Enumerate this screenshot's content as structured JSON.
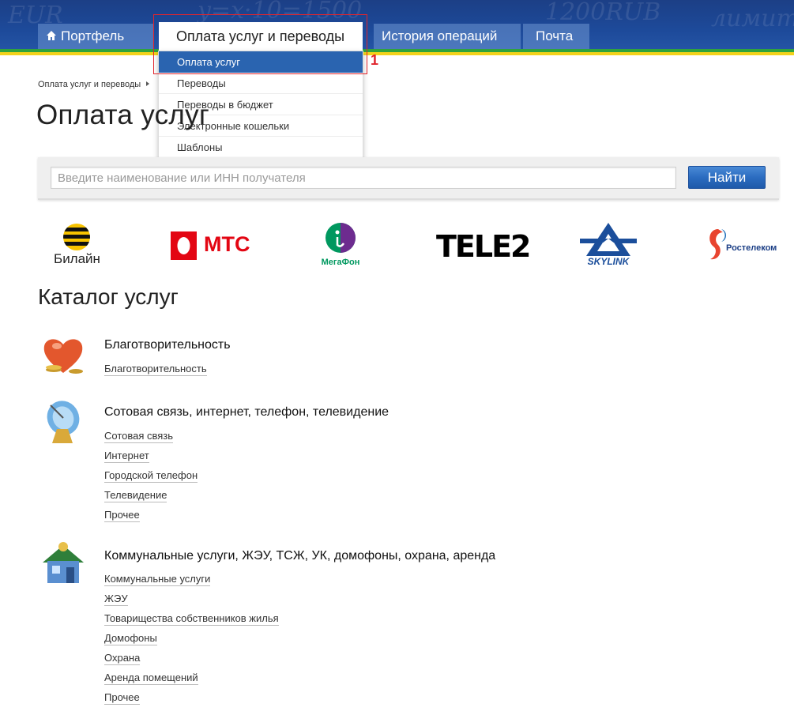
{
  "header": {
    "nav": {
      "portfolio": "Портфель",
      "payments": "Оплата услуг и переводы",
      "history": "История операций",
      "mail": "Почта"
    },
    "scribbles": [
      "EUR",
      "y=x·10=1500",
      "1200RUB",
      "лимит"
    ]
  },
  "dropdown": {
    "items": [
      "Оплата услуг",
      "Переводы",
      "Переводы в бюджет",
      "Электронные кошельки",
      "Шаблоны"
    ],
    "annotation": "1"
  },
  "breadcrumb": "Оплата услуг и переводы",
  "page_title": "Оплата услуг",
  "search": {
    "placeholder": "Введите наименование или ИНН получателя",
    "button": "Найти"
  },
  "operators": {
    "beeline": "Билайн",
    "mts": "МТС",
    "megafon": "МегаФон",
    "tele2": "TELE2",
    "skylink": "SKYLINK",
    "rostelecom": "Ростелеком"
  },
  "catalog": {
    "title": "Каталог услуг",
    "categories": [
      {
        "title": "Благотворительность",
        "links": [
          "Благотворительность"
        ]
      },
      {
        "title": "Сотовая связь, интернет, телефон, телевидение",
        "links": [
          "Сотовая связь",
          "Интернет",
          "Городской телефон",
          "Телевидение",
          "Прочее"
        ]
      },
      {
        "title": "Коммунальные услуги, ЖЭУ, ТСЖ, УК, домофоны, охрана, аренда",
        "links": [
          "Коммунальные услуги",
          "ЖЭУ",
          "Товарищества собственников жилья",
          "Домофоны",
          "Охрана",
          "Аренда помещений",
          "Прочее"
        ]
      }
    ]
  }
}
